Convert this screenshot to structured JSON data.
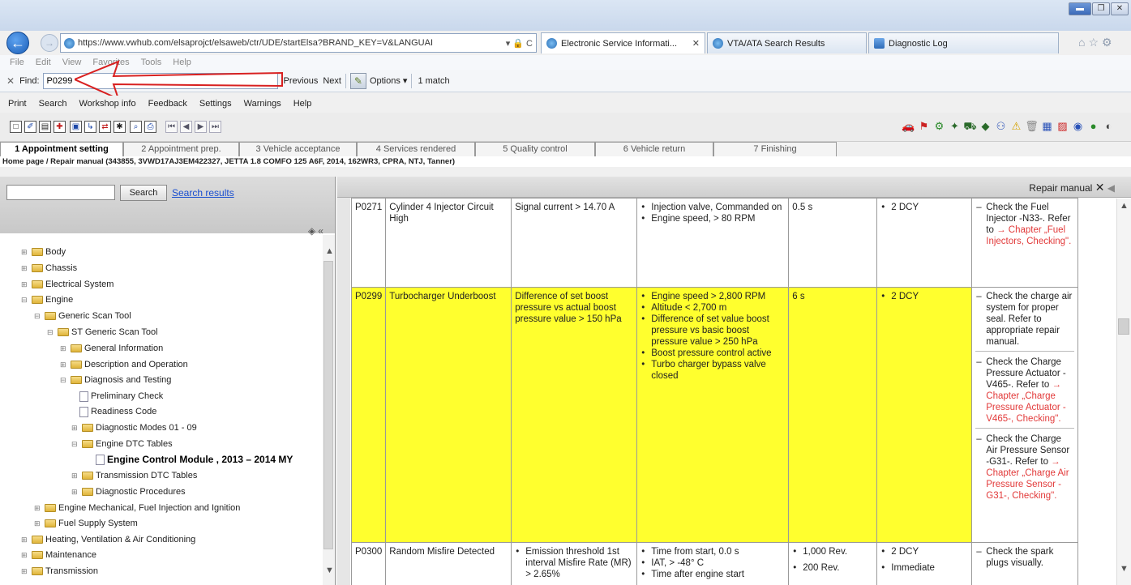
{
  "browser": {
    "url": "https://www.vwhub.com/elsaprojct/elsaweb/ctr/UDE/startElsa?BRAND_KEY=V&LANGUAI",
    "url_host": "vwhub.com",
    "addr_icons": "▾ 🔒 C",
    "tabs": [
      {
        "label": "Electronic Service Informati...",
        "active": true
      },
      {
        "label": "VTA/ATA Search Results",
        "active": false
      },
      {
        "label": "Diagnostic Log",
        "active": false
      }
    ],
    "menu": [
      "File",
      "Edit",
      "View",
      "Favorites",
      "Tools",
      "Help"
    ],
    "find": {
      "label": "Find:",
      "value": "P0299",
      "previous": "Previous",
      "next": "Next",
      "options": "Options ▾",
      "match_count": "1 match"
    }
  },
  "app": {
    "menu": [
      "Print",
      "Search",
      "Workshop info",
      "Feedback",
      "Settings",
      "Warnings",
      "Help"
    ],
    "steps": [
      "1 Appointment setting",
      "2 Appointment prep.",
      "3 Vehicle acceptance",
      "4 Services rendered",
      "5 Quality control",
      "6 Vehicle return",
      "7 Finishing"
    ],
    "breadcrumb": "Home page / Repair manual (343855, 3VWD17AJ3EM422327, JETTA 1.8 COMFO 125 A6F, 2014, 162WR3, CPRA, NTJ, Tanner)",
    "search_button": "Search",
    "search_results_link": "Search results",
    "tree": [
      {
        "label": "Body",
        "level": 1,
        "type": "folder"
      },
      {
        "label": "Chassis",
        "level": 1,
        "type": "folder"
      },
      {
        "label": "Electrical System",
        "level": 1,
        "type": "folder"
      },
      {
        "label": "Engine",
        "level": 1,
        "type": "folder"
      },
      {
        "label": "Generic Scan Tool",
        "level": 2,
        "type": "folder"
      },
      {
        "label": "ST Generic Scan Tool",
        "level": 3,
        "type": "folder"
      },
      {
        "label": "General Information",
        "level": 4,
        "type": "folder"
      },
      {
        "label": "Description and Operation",
        "level": 4,
        "type": "folder"
      },
      {
        "label": "Diagnosis and Testing",
        "level": 4,
        "type": "folder"
      },
      {
        "label": "Preliminary Check",
        "level": 5,
        "type": "doc"
      },
      {
        "label": "Readiness Code",
        "level": 5,
        "type": "doc"
      },
      {
        "label": "Diagnostic Modes 01 - 09",
        "level": 4,
        "type": "folder"
      },
      {
        "label": "Engine DTC Tables",
        "level": 4,
        "type": "folder"
      },
      {
        "label": "Engine Control Module , 2013 – 2014 MY",
        "level": 5,
        "type": "doc",
        "bold": true
      },
      {
        "label": "Transmission DTC Tables",
        "level": 4,
        "type": "folder"
      },
      {
        "label": "Diagnostic Procedures",
        "level": 4,
        "type": "folder"
      },
      {
        "label": "Engine Mechanical, Fuel Injection and Ignition",
        "level": 2,
        "type": "folder"
      },
      {
        "label": "Fuel Supply System",
        "level": 2,
        "type": "folder"
      },
      {
        "label": "Heating, Ventilation & Air Conditioning",
        "level": 1,
        "type": "folder"
      },
      {
        "label": "Maintenance",
        "level": 1,
        "type": "folder"
      },
      {
        "label": "Transmission",
        "level": 1,
        "type": "folder"
      }
    ],
    "repair_manual_title": "Repair manual",
    "dtc_rows": [
      {
        "code": "P0271",
        "description": "Cylinder 4 Injector Circuit High",
        "condition": "Signal current > 14.70 A",
        "enable": [
          "Injection valve, Commanded on",
          "Engine speed, > 80 RPM"
        ],
        "time": "0.5 s",
        "mil": [
          "2 DCY"
        ],
        "action_text": "Check the Fuel Injector -N33-. Refer to",
        "action_ref": "→ Chapter „Fuel Injectors, Checking\".",
        "highlight": false
      },
      {
        "code": "P0299",
        "description": "Turbocharger Underboost",
        "condition": "Difference of set boost pressure vs actual boost pressure value > 150 hPa",
        "enable": [
          "Engine speed > 2,800 RPM",
          "Altitude < 2,700 m",
          "Difference of set value boost pressure vs basic boost pressure value > 250 hPa",
          "Boost pressure control active",
          "Turbo charger bypass valve closed"
        ],
        "time": "6 s",
        "mil": [
          "2 DCY"
        ],
        "actions": [
          {
            "text": "Check the charge air system for proper seal. Refer to appropriate repair manual.",
            "ref": ""
          },
          {
            "text": "Check the Charge Pressure Actuator -V465-. Refer to",
            "ref": "→ Chapter „Charge Pressure Actuator -V465-, Checking\"."
          },
          {
            "text": "Check the Charge Air Pressure Sensor -G31-. Refer to",
            "ref": "→ Chapter „Charge Air Pressure Sensor -G31-, Checking\"."
          }
        ],
        "highlight": true
      },
      {
        "code": "P0300",
        "description": "Random Misfire Detected",
        "condition": "Emission threshold 1st interval Misfire Rate (MR) > 2.65%",
        "enable": [
          "Time from start, 0.0 s",
          "IAT, > -48° C",
          "Time after engine start"
        ],
        "time_list": [
          "1,000 Rev.",
          "200 Rev."
        ],
        "mil": [
          "2 DCY",
          "Immediate"
        ],
        "action_text": "Check the spark plugs visually.",
        "highlight": false
      }
    ]
  }
}
